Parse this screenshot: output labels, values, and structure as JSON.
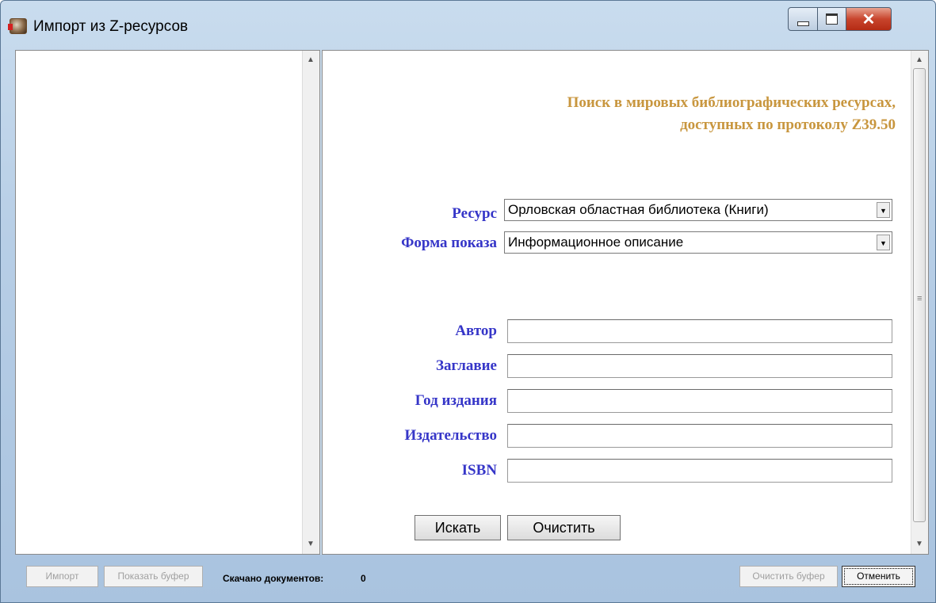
{
  "window": {
    "title": "Импорт из Z-ресурсов",
    "icon": "app-books-icon"
  },
  "form": {
    "heading_line1": "Поиск в мировых библиографических ресурсах,",
    "heading_line2": "доступных по протоколу Z39.50",
    "resource_label": "Ресурс",
    "resource_value": "Орловская областная библиотека (Книги)",
    "display_label": "Форма показа",
    "display_value": "Информационное описание",
    "fields": [
      {
        "label": "Автор",
        "value": ""
      },
      {
        "label": "Заглавие",
        "value": ""
      },
      {
        "label": "Год издания",
        "value": ""
      },
      {
        "label": "Издательство",
        "value": ""
      },
      {
        "label": "ISBN",
        "value": ""
      }
    ],
    "search_button": "Искать",
    "clear_button": "Очистить"
  },
  "statusbar": {
    "import_button": "Импорт",
    "show_buffer_button": "Показать буфер",
    "downloaded_label": "Скачано документов:",
    "downloaded_count": "0",
    "clear_buffer_button": "Очистить буфер",
    "cancel_button": "Отменить"
  },
  "colors": {
    "heading": "#c8963e",
    "label": "#3636c8",
    "title_bar": "#b7cee6"
  }
}
